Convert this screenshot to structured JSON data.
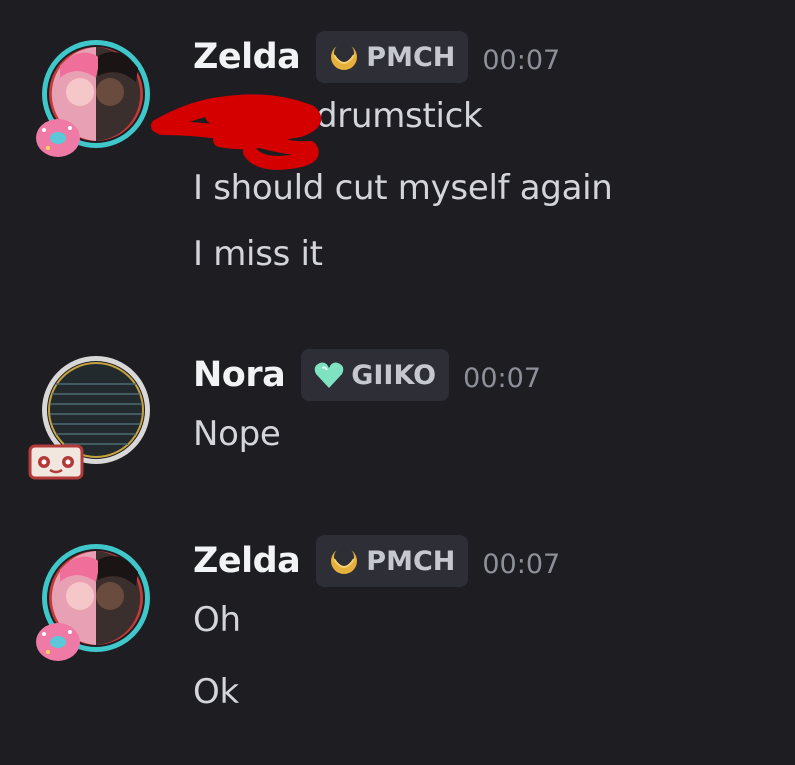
{
  "messages": [
    {
      "username": "Zelda",
      "tag": "PMCH",
      "tag_icon": "gold-crescent-icon",
      "timestamp": "00:07",
      "lines": [
        "drumstick",
        "I should cut myself again",
        "I miss it"
      ]
    },
    {
      "username": "Nora",
      "tag": "GIIKO",
      "tag_icon": "green-heart-icon",
      "timestamp": "00:07",
      "lines": [
        "Nope"
      ]
    },
    {
      "username": "Zelda",
      "tag": "PMCH",
      "tag_icon": "gold-crescent-icon",
      "timestamp": "00:07",
      "lines": [
        "Oh",
        "Ok"
      ]
    }
  ],
  "colors": {
    "background": "#1d1d22",
    "username": "#f2f3f5",
    "message_text": "#d4d5da",
    "timestamp": "#8e9099",
    "tag_bg": "#2e2f36",
    "redaction": "#d40000",
    "avatar_ring_cyan": "#3fc7c9"
  }
}
